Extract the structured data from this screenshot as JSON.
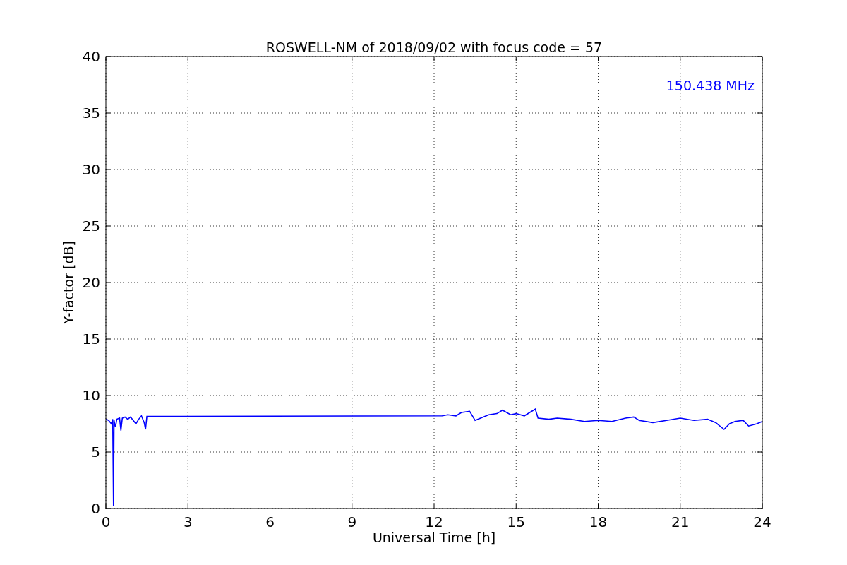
{
  "chart_data": {
    "type": "line",
    "title": "ROSWELL-NM of 2018/09/02 with focus code = 57",
    "xlabel": "Universal Time [h]",
    "ylabel": "Y-factor [dB]",
    "x": [
      0,
      0.1,
      0.2,
      0.25,
      0.28,
      0.3,
      0.35,
      0.4,
      0.5,
      0.55,
      0.6,
      0.7,
      0.8,
      0.9,
      1.0,
      1.1,
      1.2,
      1.3,
      1.4,
      1.45,
      1.5,
      12.3,
      12.5,
      12.8,
      13.0,
      13.3,
      13.5,
      13.7,
      14.0,
      14.3,
      14.5,
      14.8,
      15.0,
      15.3,
      15.5,
      15.7,
      15.8,
      16.2,
      16.5,
      17,
      17.5,
      18,
      18.5,
      19,
      19.3,
      19.5,
      20,
      20.5,
      21,
      21.5,
      22,
      22.3,
      22.6,
      22.8,
      23,
      23.3,
      23.5,
      23.8,
      24
    ],
    "series": [
      {
        "name": "150.438 MHz",
        "color": "#0000ff",
        "values": [
          7.9,
          7.8,
          7.5,
          7.9,
          0.2,
          7.8,
          7.2,
          7.9,
          8.0,
          6.9,
          8.0,
          8.1,
          7.9,
          8.1,
          7.8,
          7.5,
          7.9,
          8.2,
          7.6,
          7.0,
          8.15,
          8.2,
          8.3,
          8.2,
          8.5,
          8.6,
          7.8,
          8.0,
          8.3,
          8.4,
          8.7,
          8.3,
          8.4,
          8.2,
          8.5,
          8.8,
          8.0,
          7.9,
          8.0,
          7.9,
          7.7,
          7.8,
          7.7,
          8.0,
          8.1,
          7.8,
          7.6,
          7.8,
          8.0,
          7.8,
          7.9,
          7.6,
          7.0,
          7.5,
          7.7,
          7.8,
          7.3,
          7.5,
          7.7
        ]
      }
    ],
    "grid": true,
    "xlim": [
      0,
      24
    ],
    "ylim": [
      0,
      40
    ],
    "xticks": [
      0,
      3,
      6,
      9,
      12,
      15,
      18,
      21,
      24
    ],
    "yticks": [
      0,
      5,
      10,
      15,
      20,
      25,
      30,
      35,
      40
    ]
  }
}
